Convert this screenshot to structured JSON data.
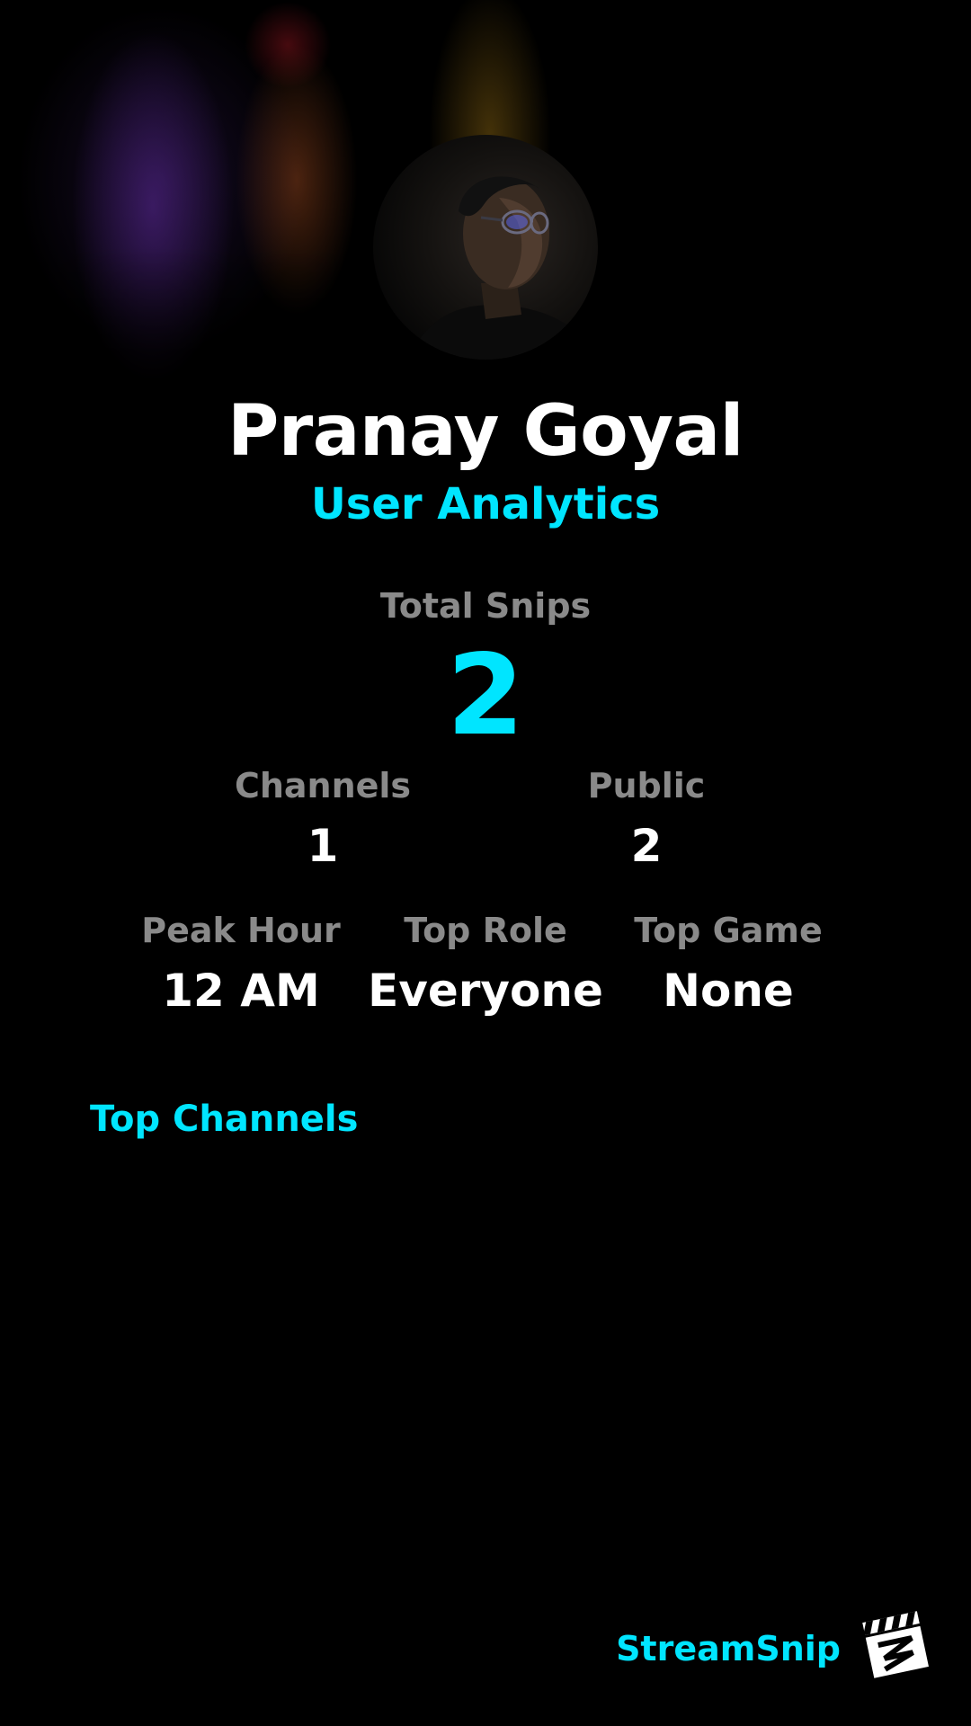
{
  "profile": {
    "name": "Pranay Goyal",
    "subtitle": "User Analytics"
  },
  "stats": {
    "total_snips": {
      "label": "Total Snips",
      "value": "2"
    },
    "channels": {
      "label": "Channels",
      "value": "1"
    },
    "public": {
      "label": "Public",
      "value": "2"
    },
    "peak_hour": {
      "label": "Peak Hour",
      "value": "12 AM"
    },
    "top_role": {
      "label": "Top Role",
      "value": "Everyone"
    },
    "top_game": {
      "label": "Top Game",
      "value": "None"
    }
  },
  "sections": {
    "top_channels": "Top Channels"
  },
  "brand": {
    "name": "StreamSnip",
    "logo_icon": "clapperboard-logo-icon"
  },
  "colors": {
    "accent": "#00e5ff",
    "label": "#8a8a8a",
    "background": "#000000",
    "text": "#ffffff"
  }
}
